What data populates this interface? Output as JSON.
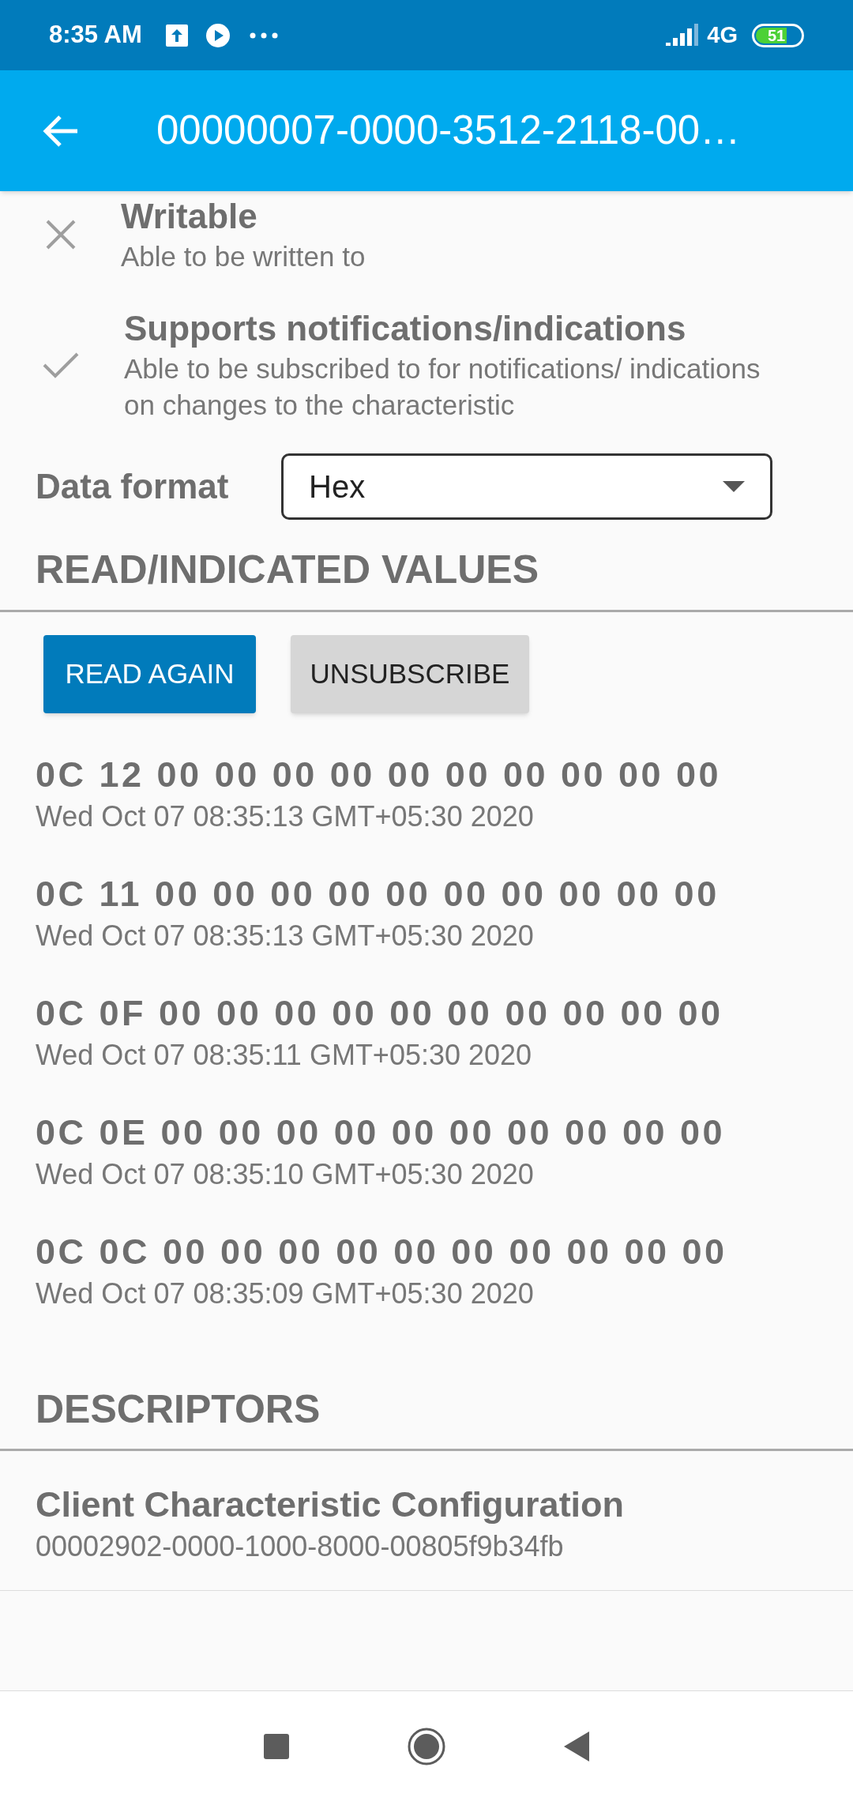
{
  "status_bar": {
    "time": "8:35 AM",
    "network": "4G",
    "battery": "51"
  },
  "app_bar": {
    "title": "00000007-0000-3512-2118-00…"
  },
  "properties": [
    {
      "title": "Writable",
      "description": "Able to be written to",
      "supported": false
    },
    {
      "title": "Supports notifications/indications",
      "description": "Able to be subscribed to for notifications/ indications on changes to the characteristic",
      "supported": true
    }
  ],
  "data_format": {
    "label": "Data format",
    "value": "Hex"
  },
  "values_section": {
    "header": "READ/INDICATED VALUES",
    "buttons": [
      {
        "label": "READ AGAIN",
        "kind": "primary"
      },
      {
        "label": "UNSUBSCRIBE",
        "kind": "secondary"
      }
    ],
    "values": [
      {
        "value": "0C 12 00 00 00 00 00 00 00 00 00 00",
        "time": "Wed Oct 07 08:35:13 GMT+05:30 2020"
      },
      {
        "value": "0C 11 00 00 00 00 00 00 00 00 00 00",
        "time": "Wed Oct 07 08:35:13 GMT+05:30 2020"
      },
      {
        "value": "0C 0F 00 00 00 00 00 00 00 00 00 00",
        "time": "Wed Oct 07 08:35:11 GMT+05:30 2020"
      },
      {
        "value": "0C 0E 00 00 00 00 00 00 00 00 00 00",
        "time": "Wed Oct 07 08:35:10 GMT+05:30 2020"
      },
      {
        "value": "0C 0C 00 00 00 00 00 00 00 00 00 00",
        "time": "Wed Oct 07 08:35:09 GMT+05:30 2020"
      }
    ]
  },
  "descriptors": {
    "header": "DESCRIPTORS",
    "items": [
      {
        "name": "Client Characteristic Configuration",
        "uuid": "00002902-0000-1000-8000-00805f9b34fb"
      }
    ]
  }
}
